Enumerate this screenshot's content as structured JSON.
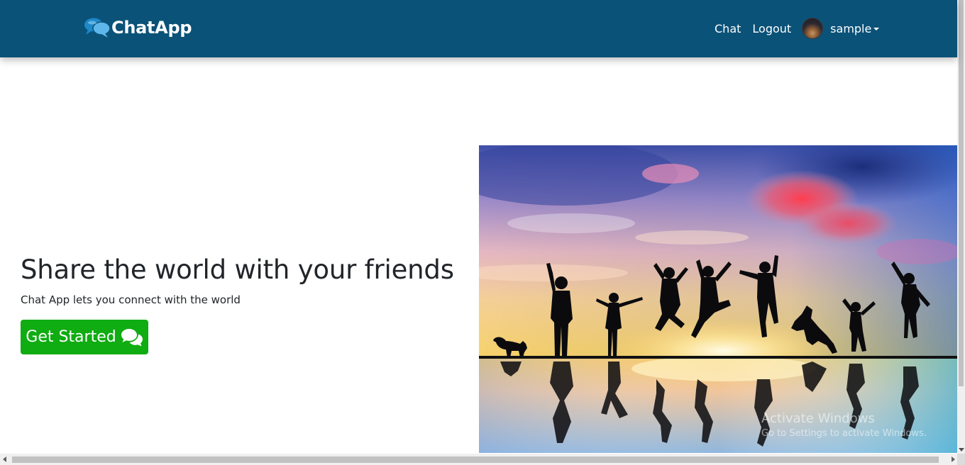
{
  "navbar": {
    "brand": "ChatApp",
    "links": [
      "Chat",
      "Logout"
    ],
    "user": "sample",
    "background": "#0a5278"
  },
  "hero": {
    "title": "Share the world with your friends",
    "subtitle": "Chat App lets you connect with the world",
    "cta_label": "Get Started",
    "cta_color": "#0fac12",
    "cta_icon": "comments-icon"
  },
  "watermark": {
    "title": "Activate Windows",
    "subtitle": "Go to Settings to activate Windows."
  }
}
